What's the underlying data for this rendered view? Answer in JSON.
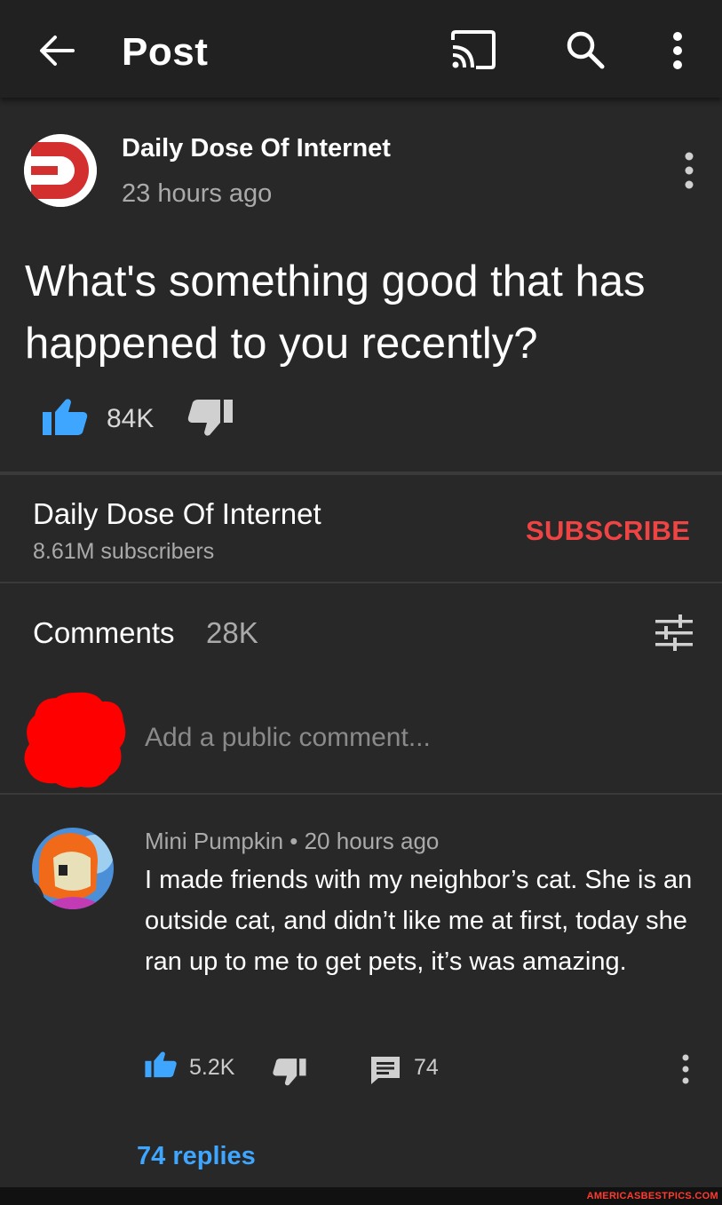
{
  "appbar": {
    "title": "Post",
    "back_icon": "arrow-left-icon",
    "cast_icon": "cast-icon",
    "search_icon": "search-icon",
    "more_icon": "more-vertical-icon"
  },
  "post": {
    "channel_name": "Daily Dose Of Internet",
    "time": "23 hours ago",
    "text": "What's something good that has happened to you recently?",
    "likes": "84K",
    "accent_color": "#d32f2f"
  },
  "channel": {
    "name": "Daily Dose Of Internet",
    "subscribers": "8.61M subscribers",
    "subscribe_label": "SUBSCRIBE",
    "subscribe_color": "#ef4444"
  },
  "comments": {
    "title": "Comments",
    "count": "28K",
    "sort_icon": "sort-filter-icon",
    "add_placeholder": "Add a public comment...",
    "items": [
      {
        "meta": "Mini Pumpkin • 20 hours ago",
        "text": "I made friends with my neighbor’s cat. She is an outside cat, and didn’t like me at first, today she ran up to me to get pets, it’s was amazing.",
        "likes": "5.2K",
        "reply_count": "74",
        "replies_label": "74 replies",
        "replies_color": "#3ea6ff"
      }
    ]
  },
  "watermark": "AMERICASBESTPICS.COM"
}
